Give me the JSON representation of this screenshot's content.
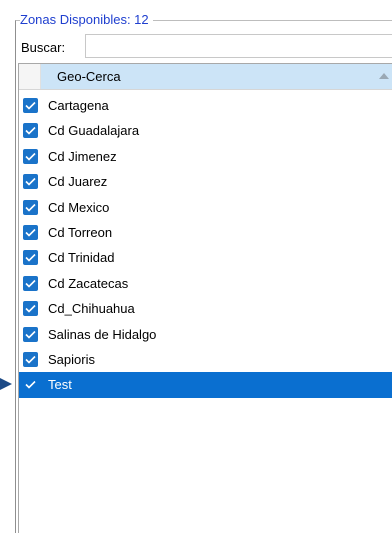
{
  "group": {
    "legend": "Zonas Disponibles: 12"
  },
  "search": {
    "label": "Buscar:",
    "value": "",
    "placeholder": ""
  },
  "list": {
    "column_header": "Geo-Cerca",
    "sort": "ascending",
    "items": [
      {
        "label": "Cartagena",
        "checked": true,
        "selected": false
      },
      {
        "label": "Cd Guadalajara",
        "checked": true,
        "selected": false
      },
      {
        "label": "Cd Jimenez",
        "checked": true,
        "selected": false
      },
      {
        "label": "Cd Juarez",
        "checked": true,
        "selected": false
      },
      {
        "label": "Cd Mexico",
        "checked": true,
        "selected": false
      },
      {
        "label": "Cd Torreon",
        "checked": true,
        "selected": false
      },
      {
        "label": "Cd Trinidad",
        "checked": true,
        "selected": false
      },
      {
        "label": "Cd Zacatecas",
        "checked": true,
        "selected": false
      },
      {
        "label": "Cd_Chihuahua",
        "checked": true,
        "selected": false
      },
      {
        "label": "Salinas de Hidalgo",
        "checked": true,
        "selected": false
      },
      {
        "label": "Sapioris",
        "checked": true,
        "selected": false
      },
      {
        "label": "Test",
        "checked": true,
        "selected": true
      }
    ]
  },
  "colors": {
    "legend_text": "#1f3fcf",
    "header_bg": "#cce4f7",
    "selection_bg": "#0a6fd0",
    "checkbox_fill": "#1a73c9",
    "pointer_arrow": "#1c4a86"
  },
  "icons": {
    "checkbox": "checkbox-checked-icon",
    "sort": "sort-ascending-icon",
    "pointer": "pointer-arrow-icon"
  }
}
